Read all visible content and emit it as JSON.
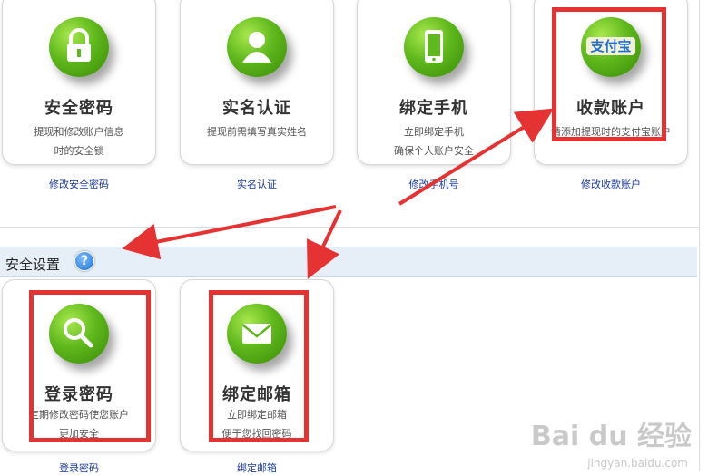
{
  "cards_top": [
    {
      "title": "安全密码",
      "desc": [
        "提现和修改账户信息",
        "时的安全锁"
      ],
      "link": "修改安全密码",
      "icon": "lock-icon"
    },
    {
      "title": "实名认证",
      "desc": [
        "提现前需填写真实姓名"
      ],
      "link": "实名认证",
      "icon": "user-icon"
    },
    {
      "title": "绑定手机",
      "desc": [
        "立即绑定手机",
        "确保个人账户安全"
      ],
      "link": "修改手机号",
      "icon": "phone-icon"
    },
    {
      "title": "收款账户",
      "desc": [
        "请添加提现时的支付宝账户"
      ],
      "link": "修改收款账户",
      "icon": "alipay-logo",
      "logo_text": "支付宝"
    }
  ],
  "section": {
    "title": "安全设置",
    "help": "?"
  },
  "cards_bottom": [
    {
      "title": "登录密码",
      "desc": [
        "定期修改密码使您账户",
        "更加安全"
      ],
      "link": "登录密码",
      "icon": "magnifier-icon"
    },
    {
      "title": "绑定邮箱",
      "desc": [
        "立即绑定邮箱",
        "便于您找回密码"
      ],
      "link": "绑定邮箱",
      "icon": "mail-icon"
    }
  ],
  "watermark": {
    "main": "Bai du 经验",
    "sub": "jingyan.baidu.com"
  },
  "colors": {
    "highlight": "#e53333",
    "link": "#1a3aa0",
    "icon_green": "#5fb81c",
    "section_bg": "#e6eff7"
  }
}
